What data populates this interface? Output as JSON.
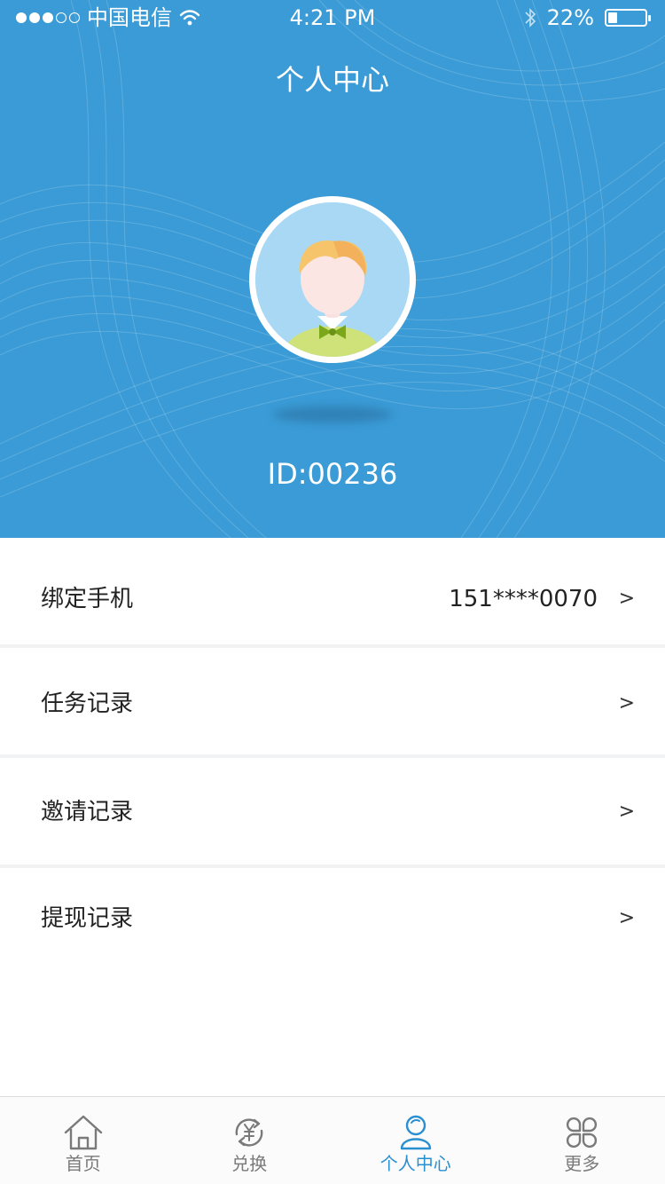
{
  "status_bar": {
    "carrier": "中国电信",
    "time": "4:21 PM",
    "battery": "22%"
  },
  "header": {
    "title": "个人中心",
    "user_id": "ID:00236"
  },
  "list": [
    {
      "label": "绑定手机",
      "value": "151****0070",
      "chevron": ">"
    },
    {
      "label": "任务记录",
      "value": "",
      "chevron": ">"
    },
    {
      "label": "邀请记录",
      "value": "",
      "chevron": ">"
    },
    {
      "label": "提现记录",
      "value": "",
      "chevron": ">"
    }
  ],
  "tabbar": {
    "active": "个人中心",
    "items": [
      {
        "label": "首页",
        "icon": "home-icon"
      },
      {
        "label": "兑换",
        "icon": "exchange-icon"
      },
      {
        "label": "个人中心",
        "icon": "user-icon"
      },
      {
        "label": "更多",
        "icon": "more-icon"
      }
    ]
  },
  "colors": {
    "header_bg": "#3a9bd6",
    "active_tab": "#2a8fd0",
    "inactive_tab": "#7a7a7a",
    "divider": "#f1f2f4"
  }
}
